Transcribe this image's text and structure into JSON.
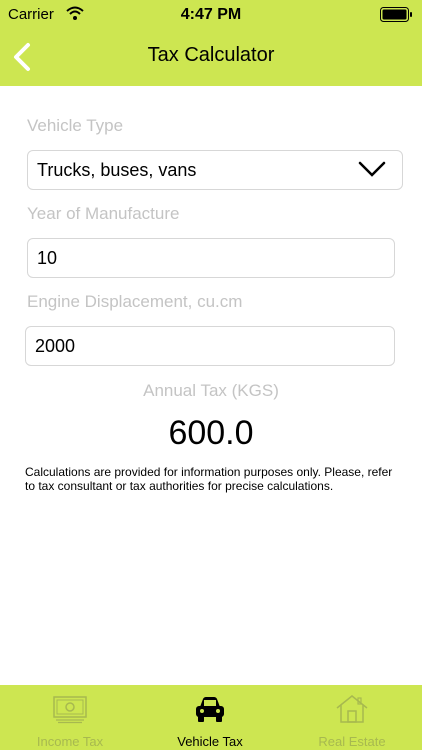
{
  "status_bar": {
    "carrier": "Carrier",
    "time": "4:47 PM"
  },
  "nav": {
    "title": "Tax Calculator",
    "back_icon": "chevron-left-icon"
  },
  "form": {
    "vehicle_type_label": "Vehicle Type",
    "vehicle_type_value": "Trucks, buses, vans",
    "year_label": "Year of Manufacture",
    "year_value": "10",
    "engine_label": "Engine Displacement, cu.cm",
    "engine_value": "2000"
  },
  "result": {
    "label": "Annual Tax (KGS)",
    "value": "600.0"
  },
  "disclaimer": "Calculations are provided for information purposes only. Please, refer to tax consultant or tax authorities for precise calculations.",
  "tabs": [
    {
      "label": "Income Tax",
      "icon": "banknote-icon",
      "active": false
    },
    {
      "label": "Vehicle Tax",
      "icon": "car-icon",
      "active": true
    },
    {
      "label": "Real Estate",
      "icon": "house-icon",
      "active": false
    }
  ],
  "colors": {
    "accent": "#cde651",
    "tab_inactive": "#a7b94f",
    "label_gray": "#c4c4c4"
  }
}
